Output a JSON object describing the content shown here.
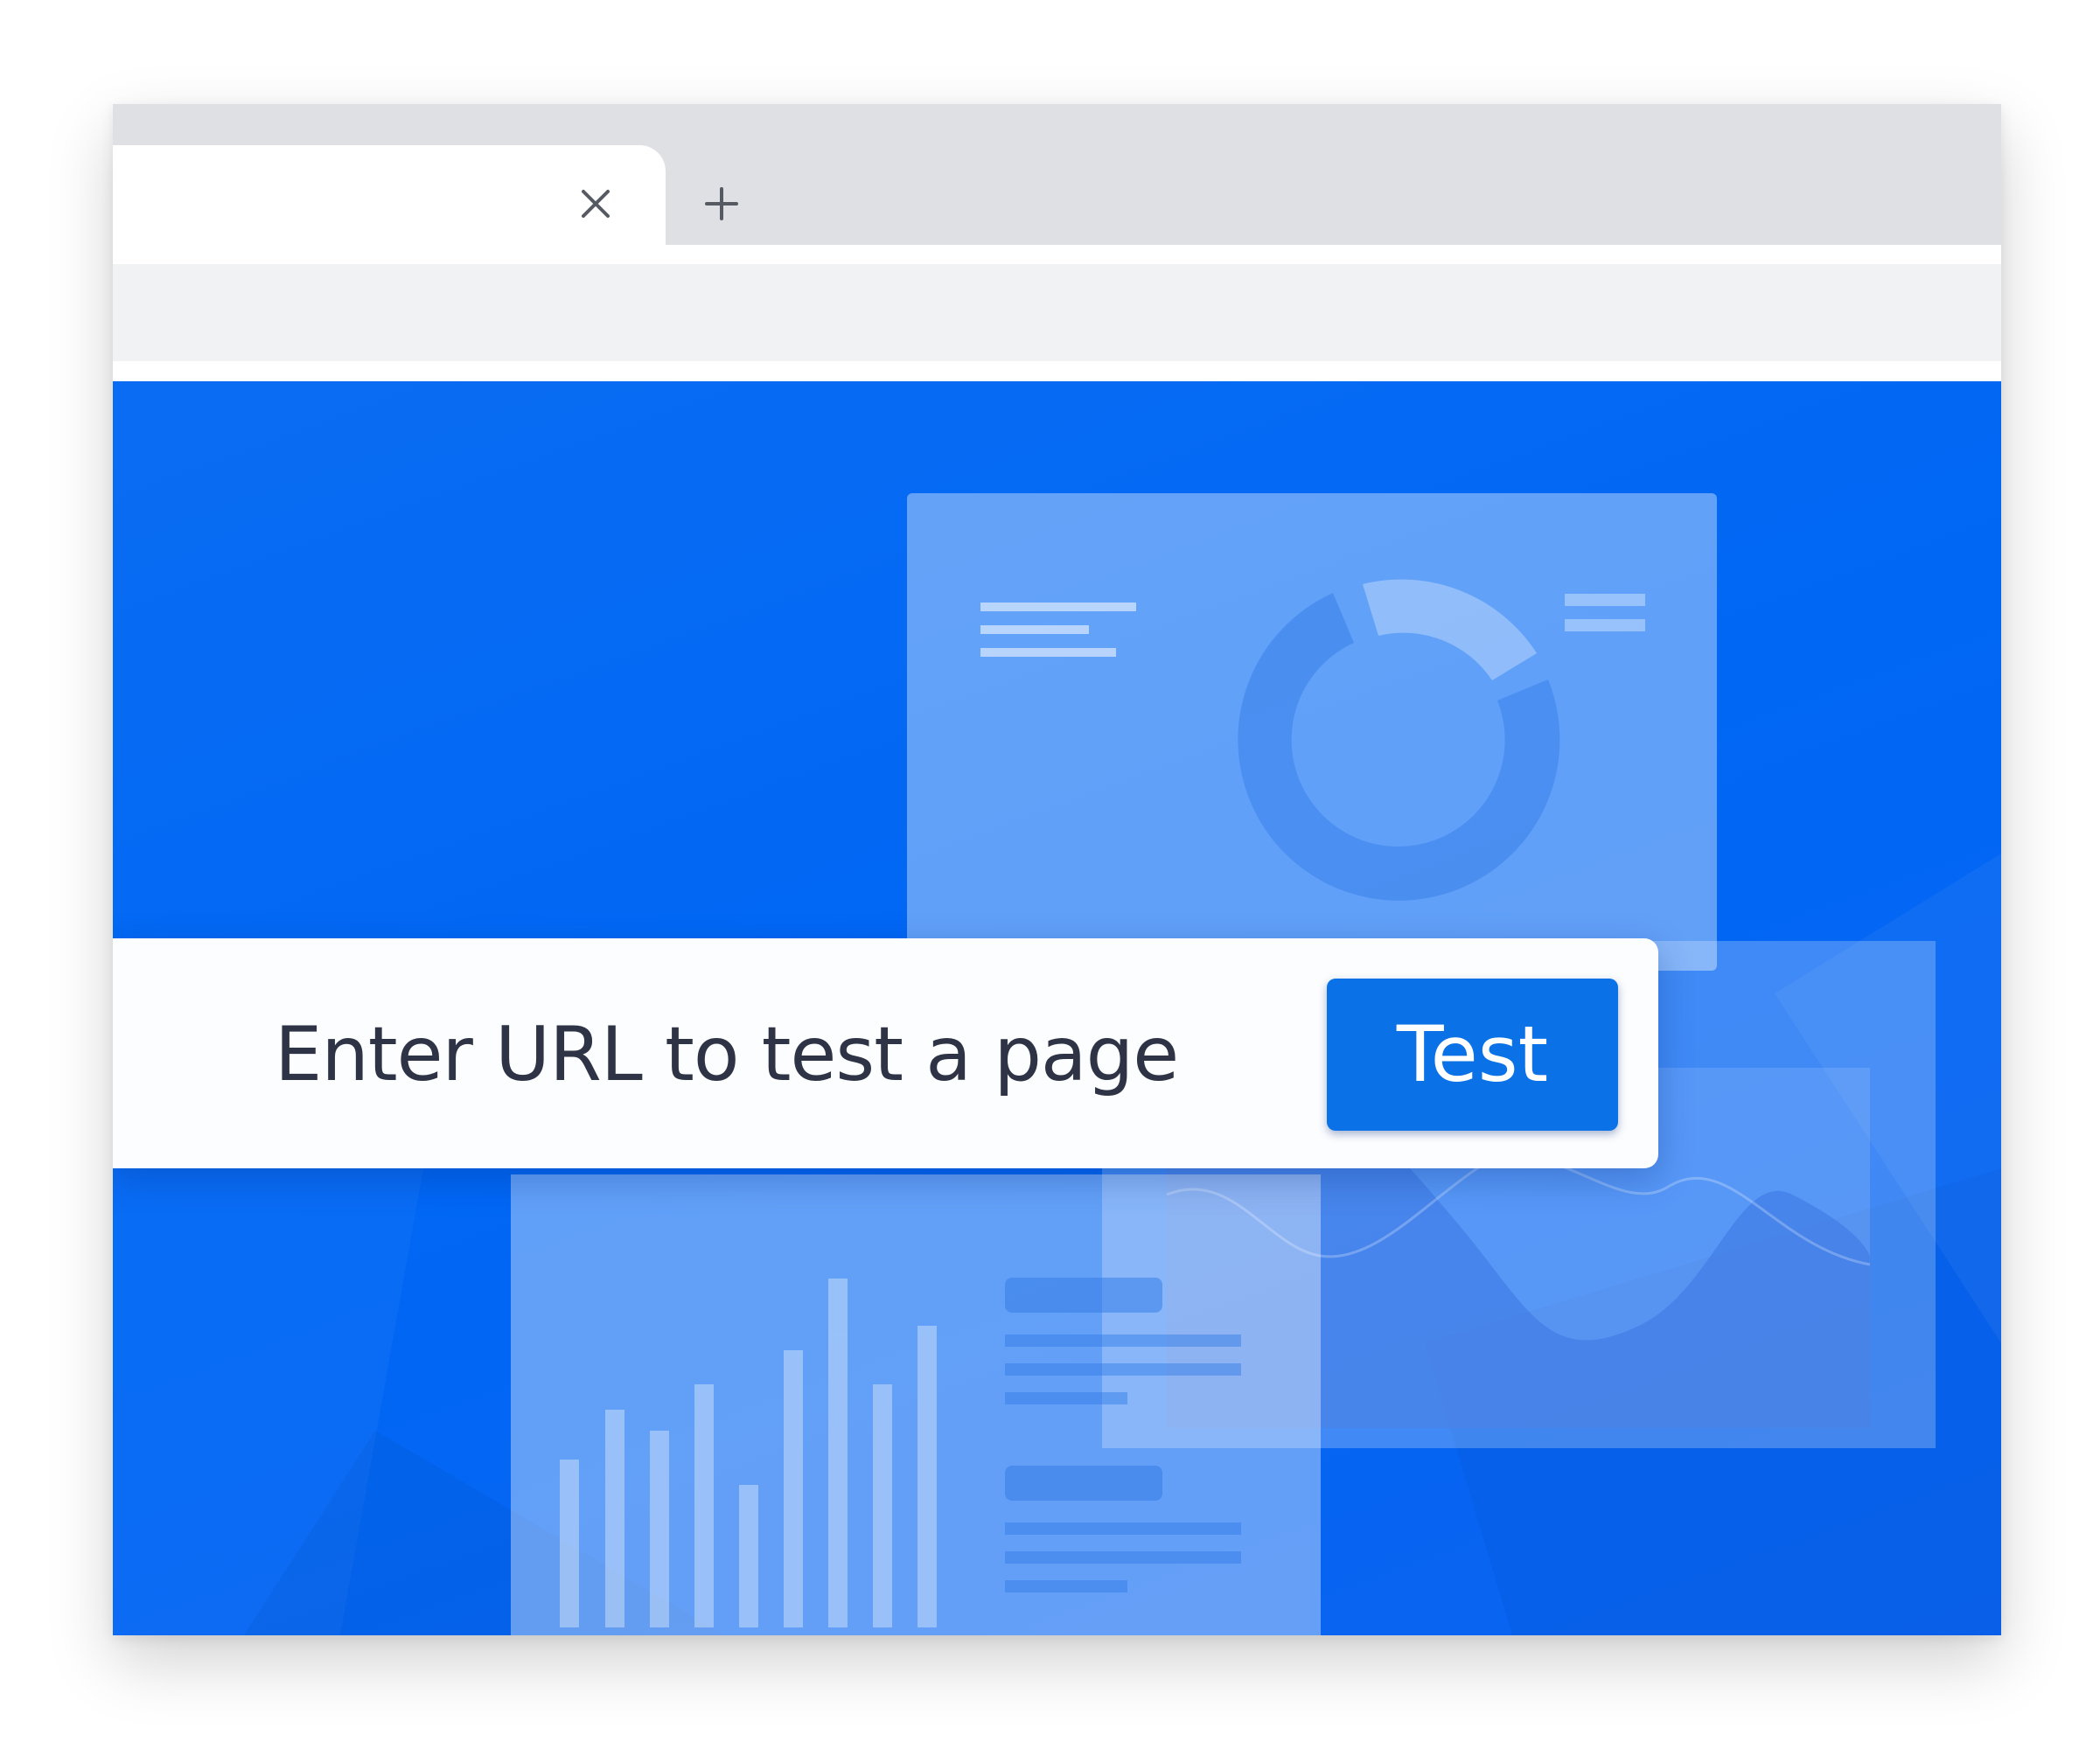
{
  "browser": {
    "tab_close_icon": "close-icon",
    "new_tab_icon": "plus-icon"
  },
  "url_form": {
    "placeholder": "Enter URL to test a page",
    "button_label": "Test"
  },
  "colors": {
    "content_background": "#0067f5",
    "button": "#0a72e6",
    "placeholder_text": "#2e3445"
  }
}
